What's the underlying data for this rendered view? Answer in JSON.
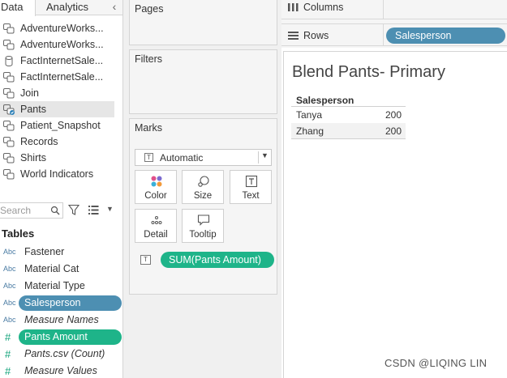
{
  "left_pane": {
    "tabs": {
      "data": "Data",
      "analytics": "Analytics",
      "collapse_glyph": "‹"
    },
    "datasources": [
      {
        "label": "AdventureWorks...",
        "icon": "datasource-icon"
      },
      {
        "label": "AdventureWorks...",
        "icon": "datasource-icon"
      },
      {
        "label": "FactInternetSale...",
        "icon": "database-icon"
      },
      {
        "label": "FactInternetSale...",
        "icon": "datasource-icon"
      },
      {
        "label": "Join",
        "icon": "datasource-icon"
      },
      {
        "label": "Pants",
        "icon": "primary-datasource-icon",
        "selected": true
      },
      {
        "label": "Patient_Snapshot",
        "icon": "datasource-icon"
      },
      {
        "label": "Records",
        "icon": "datasource-icon"
      },
      {
        "label": "Shirts",
        "icon": "datasource-icon"
      },
      {
        "label": "World Indicators",
        "icon": "datasource-icon"
      }
    ],
    "search": {
      "placeholder": "Search"
    },
    "tables_header": "Tables",
    "fields": [
      {
        "type": "Abc",
        "label": "Fastener",
        "kind": "dimension"
      },
      {
        "type": "Abc",
        "label": "Material Cat",
        "kind": "dimension"
      },
      {
        "type": "Abc",
        "label": "Material Type",
        "kind": "dimension"
      },
      {
        "type": "Abc",
        "label": "Salesperson",
        "kind": "dimension",
        "in_use": true
      },
      {
        "type": "Abc",
        "label": "Measure Names",
        "kind": "dimension",
        "italic": true
      },
      {
        "type": "#",
        "label": "Pants Amount",
        "kind": "measure",
        "in_use": true
      },
      {
        "type": "#",
        "label": "Pants.csv (Count)",
        "kind": "measure",
        "italic": true
      },
      {
        "type": "#",
        "label": "Measure Values",
        "kind": "measure",
        "italic": true
      }
    ]
  },
  "cards": {
    "pages": "Pages",
    "filters": "Filters",
    "marks": {
      "title": "Marks",
      "mark_type": "Automatic",
      "mark_type_icon_glyph": "T",
      "buttons": [
        {
          "label": "Color",
          "icon": "color-icon"
        },
        {
          "label": "Size",
          "icon": "size-icon"
        },
        {
          "label": "Text",
          "icon": "text-icon"
        },
        {
          "label": "Detail",
          "icon": "detail-icon"
        },
        {
          "label": "Tooltip",
          "icon": "tooltip-icon"
        }
      ],
      "text_pill": "SUM(Pants Amount)",
      "text_pill_glyph": "T"
    }
  },
  "shelves": {
    "columns_label": "Columns",
    "rows_label": "Rows",
    "rows_pill": "Salesperson"
  },
  "view": {
    "title": "Blend Pants- Primary",
    "table": {
      "header": "Salesperson",
      "rows": [
        {
          "name": "Tanya",
          "value": "200"
        },
        {
          "name": "Zhang",
          "value": "200"
        }
      ]
    }
  },
  "watermark": "CSDN @LIQING LIN",
  "colors": {
    "dimension_pill": "#4d8fb2",
    "measure_pill": "#1eb489",
    "dimension_type": "#4a7ba3",
    "measure_type": "#11a37a"
  }
}
